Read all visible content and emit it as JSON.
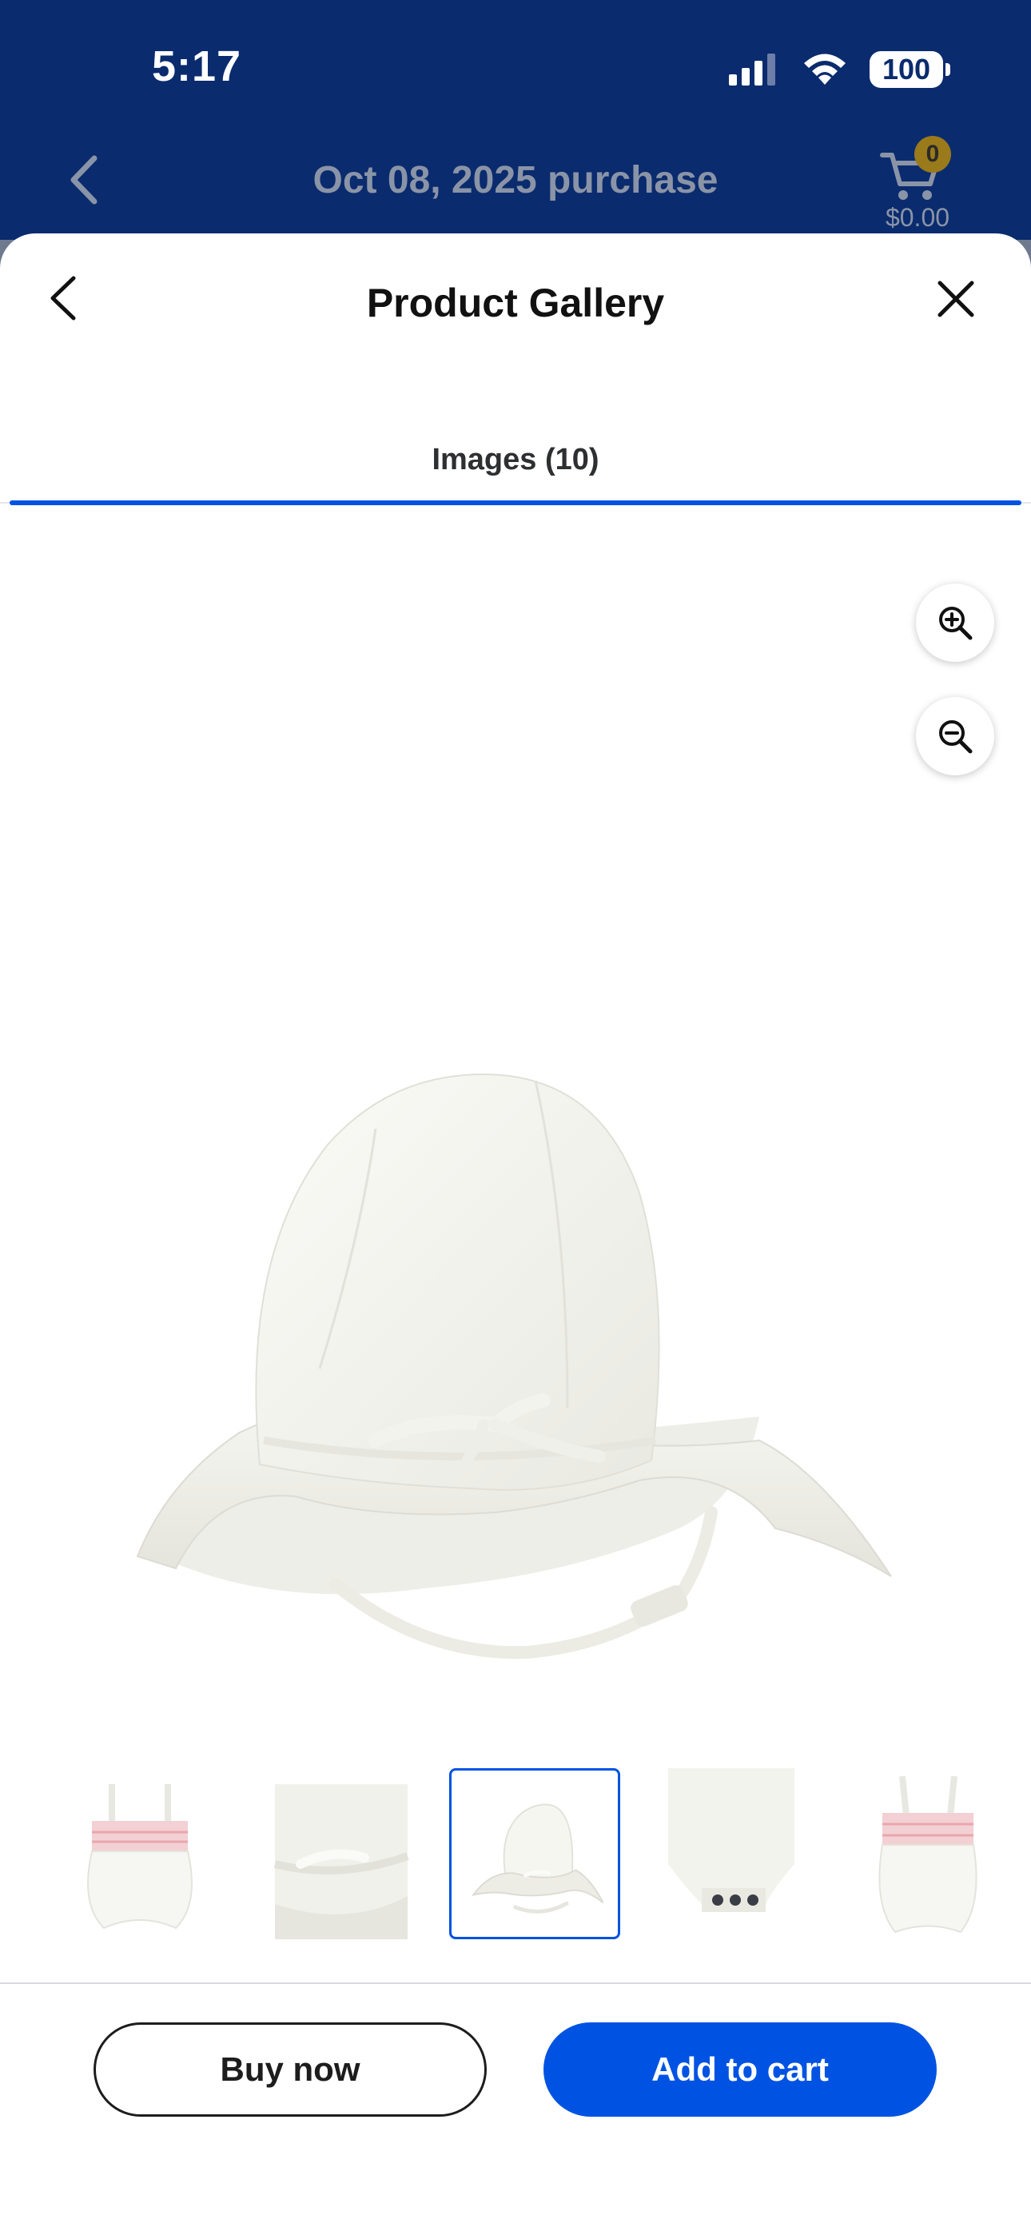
{
  "status_bar": {
    "time": "5:17",
    "battery": "100"
  },
  "header": {
    "title": "Oct 08, 2025 purchase",
    "cart_count": "0",
    "cart_total": "$0.00"
  },
  "sheet": {
    "title": "Product Gallery"
  },
  "tabs": [
    {
      "label": "Images (10)",
      "active": true
    }
  ],
  "thumbnails": [
    {
      "name": "romper-front"
    },
    {
      "name": "hat-detail"
    },
    {
      "name": "hat",
      "selected": true
    },
    {
      "name": "romper-snaps"
    },
    {
      "name": "romper-back"
    }
  ],
  "actions": {
    "buy_now": "Buy now",
    "add_to_cart": "Add to cart"
  },
  "colors": {
    "brand_blue": "#0053e2",
    "header_navy": "#0a2b6e"
  }
}
